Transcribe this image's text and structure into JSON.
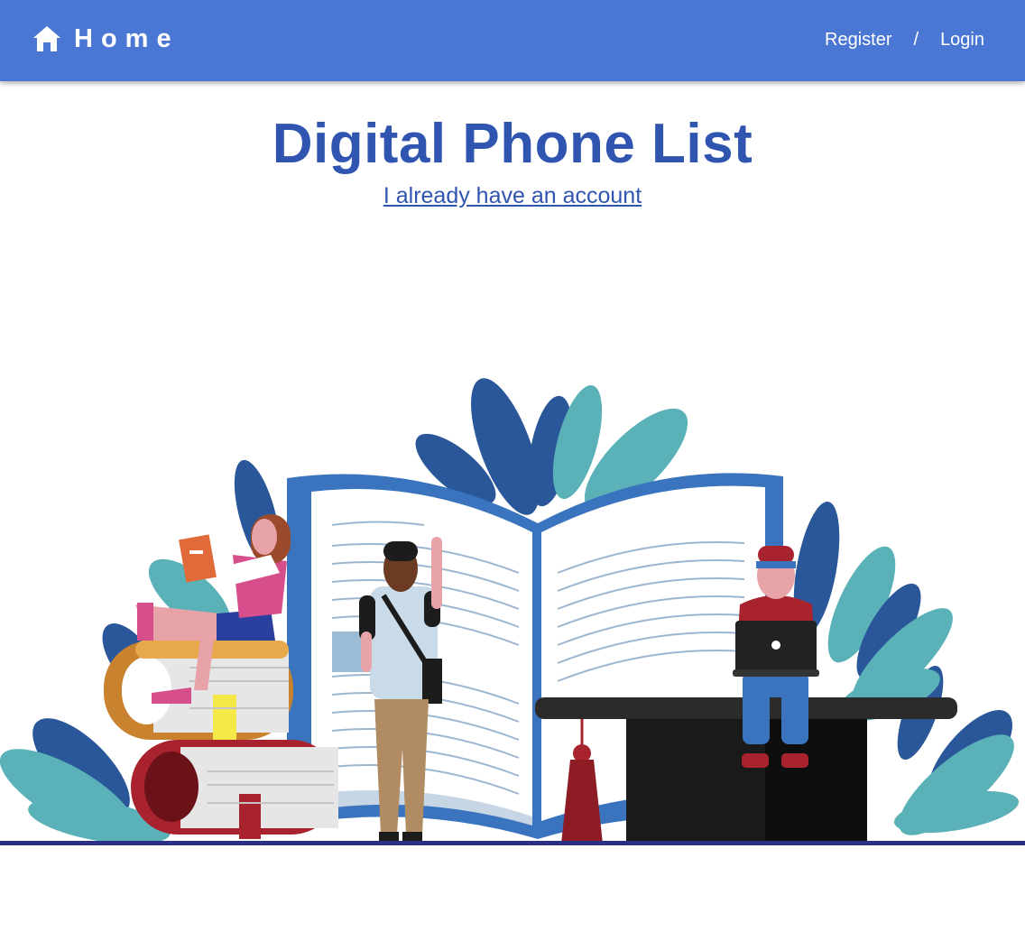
{
  "header": {
    "brand_icon": "home-icon",
    "brand_label": "Home",
    "register_label": "Register",
    "separator": "/",
    "login_label": "Login"
  },
  "hero": {
    "title": "Digital Phone List",
    "account_link": "I already have an account"
  },
  "illustration": {
    "name": "students-reading-illustration"
  },
  "colors": {
    "navbar": "#4a77d4",
    "title": "#2f55b0",
    "baseline": "#2b2f86"
  }
}
